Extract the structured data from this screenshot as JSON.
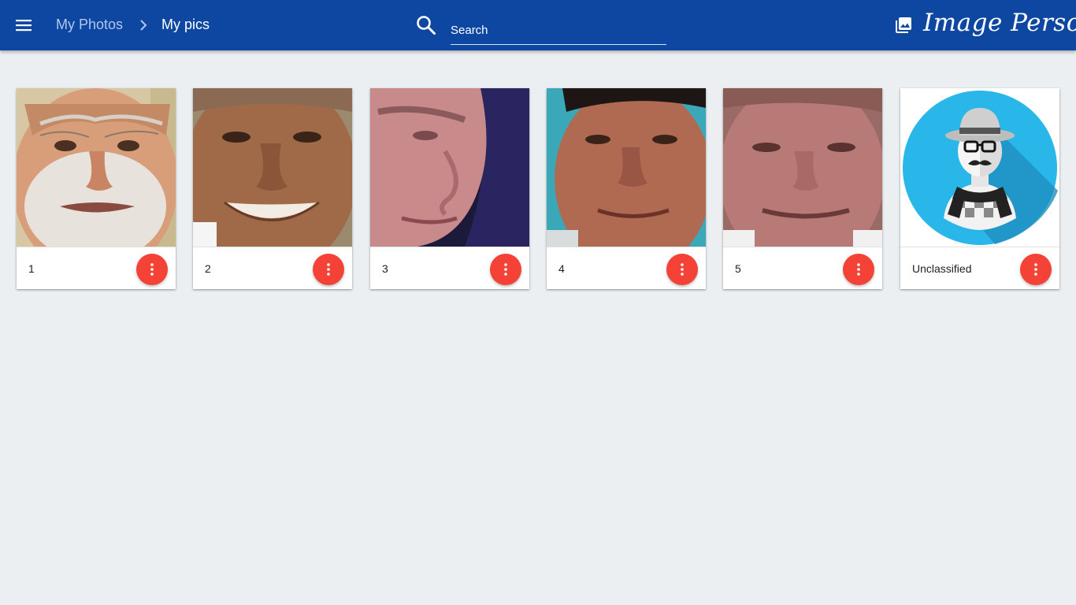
{
  "header": {
    "menu_icon": "menu-icon",
    "breadcrumb": {
      "root": "My Photos",
      "separator_icon": "chevron-right-icon",
      "current": "My pics"
    },
    "search": {
      "icon": "search-icon",
      "placeholder": "Search",
      "value": ""
    },
    "brand": {
      "icon": "photo-library-icon",
      "name": "Image Persona"
    }
  },
  "colors": {
    "header_bg": "#0d47a1",
    "page_bg": "#eceff1",
    "fab": "#f44336",
    "avatar_circle": "#29b6e8"
  },
  "cards": [
    {
      "label": "1",
      "image": "face-photo",
      "menu_icon": "more-vert-icon"
    },
    {
      "label": "2",
      "image": "face-photo",
      "menu_icon": "more-vert-icon"
    },
    {
      "label": "3",
      "image": "face-photo",
      "menu_icon": "more-vert-icon"
    },
    {
      "label": "4",
      "image": "face-photo",
      "menu_icon": "more-vert-icon"
    },
    {
      "label": "5",
      "image": "face-photo",
      "menu_icon": "more-vert-icon"
    },
    {
      "label": "Unclassified",
      "image": "hipster-avatar",
      "menu_icon": "more-vert-icon"
    }
  ]
}
